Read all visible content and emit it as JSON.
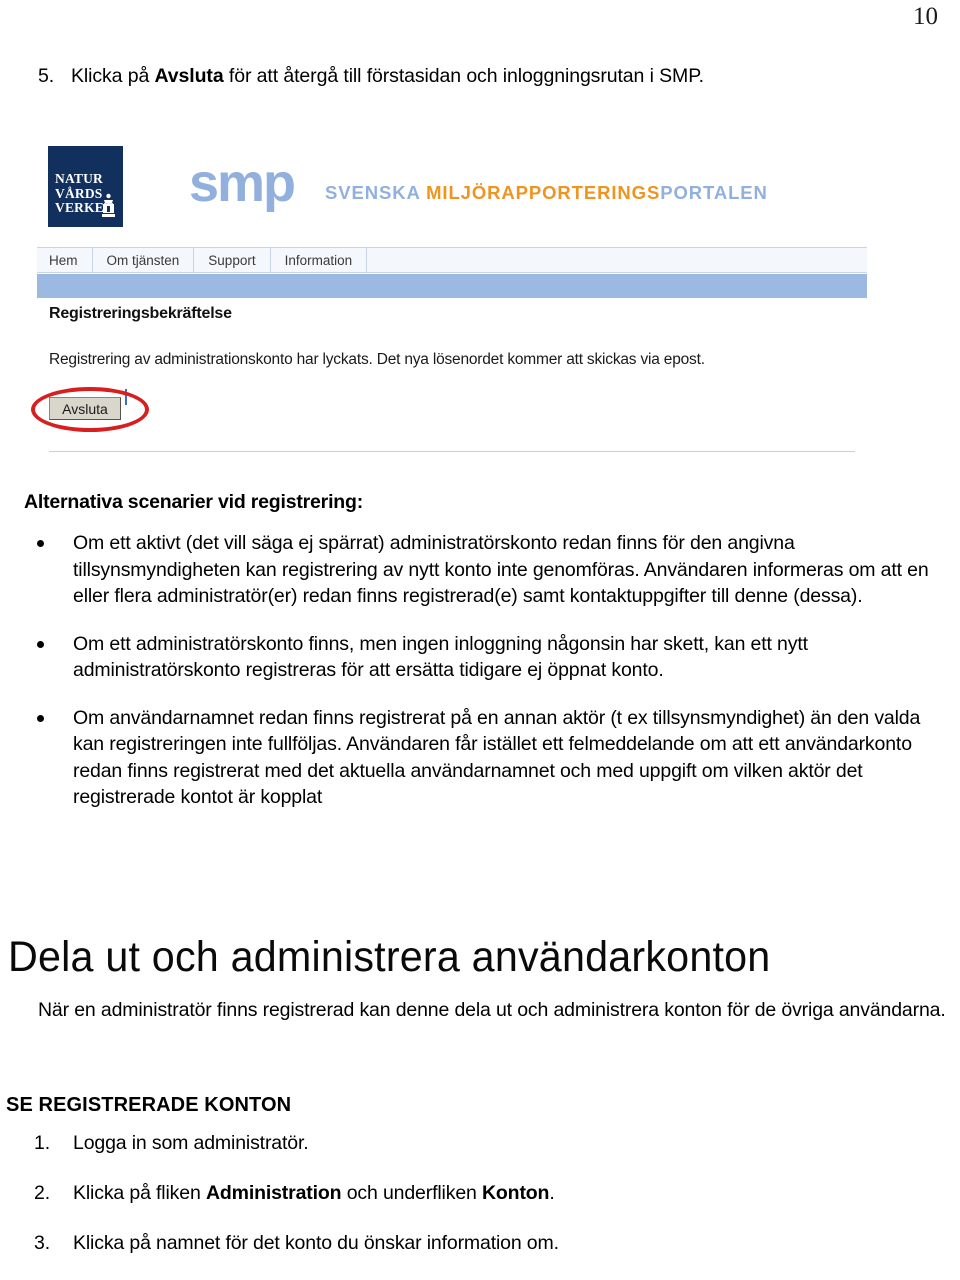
{
  "page": {
    "number": "10"
  },
  "step_top": {
    "number": "5.",
    "text_before": "Klicka på ",
    "bold": "Avsluta",
    "text_after": " för att återgå till förstasidan och inloggningsrutan i SMP."
  },
  "screenshot": {
    "logo": {
      "line1": "NATUR",
      "line2": "VÅRDS",
      "line3": "VERKET"
    },
    "brand": {
      "word": "smp",
      "tagline_blue_1": "SVENSKA ",
      "tagline_orange": "MILJÖRAPPORTERINGS",
      "tagline_blue_2": "PORTALEN"
    },
    "nav": [
      {
        "label": "Hem"
      },
      {
        "label": "Om tjänsten"
      },
      {
        "label": "Support"
      },
      {
        "label": "Information"
      }
    ],
    "content": {
      "heading": "Registreringsbekräftelse",
      "message": "Registrering av administrationskonto har lyckats. Det nya lösenordet kommer att skickas via epost.",
      "button_label": "Avsluta"
    },
    "annotation": {
      "shape": "red-ellipse",
      "color": "#d81f20",
      "targets": "Avsluta"
    }
  },
  "alternatives": {
    "heading": "Alternativa scenarier vid registrering:",
    "bullets": [
      "Om ett aktivt (det vill säga ej spärrat) administratörskonto redan finns för den angivna tillsynsmyndigheten kan registrering av nytt konto inte genomföras. Användaren informeras om att en eller flera administratör(er) redan finns registrerad(e) samt kontaktuppgifter till denne (dessa).",
      "Om ett administratörskonto finns, men ingen inloggning någonsin har skett, kan ett nytt administratörskonto registreras för att ersätta tidigare ej öppnat konto.",
      "Om användarnamnet redan finns registrerat på en annan aktör (t ex tillsynsmyndighet) än den valda kan registreringen inte fullföljas. Användaren får istället ett felmeddelande om att ett användarkonto redan finns registrerat med det aktuella användarnamnet och med uppgift om vilken aktör det registrerade kontot är kopplat"
    ]
  },
  "share_section": {
    "heading": "Dela ut och administrera användarkonton",
    "intro": "När en administratör finns registrerad kan denne dela ut och administrera konton för de övriga användarna.",
    "sub_heading": "SE REGISTRERADE KONTON",
    "steps": [
      {
        "number": "1.",
        "text_before": "Logga in som administratör.",
        "bold": "",
        "text_middle": "",
        "bold2": "",
        "text_after": ""
      },
      {
        "number": "2.",
        "text_before": "Klicka på fliken ",
        "bold": "Administration",
        "text_middle": " och underfliken ",
        "bold2": "Konton",
        "text_after": "."
      },
      {
        "number": "3.",
        "text_before": "Klicka på namnet för det konto du önskar information om.",
        "bold": "",
        "text_middle": "",
        "bold2": "",
        "text_after": ""
      }
    ]
  }
}
